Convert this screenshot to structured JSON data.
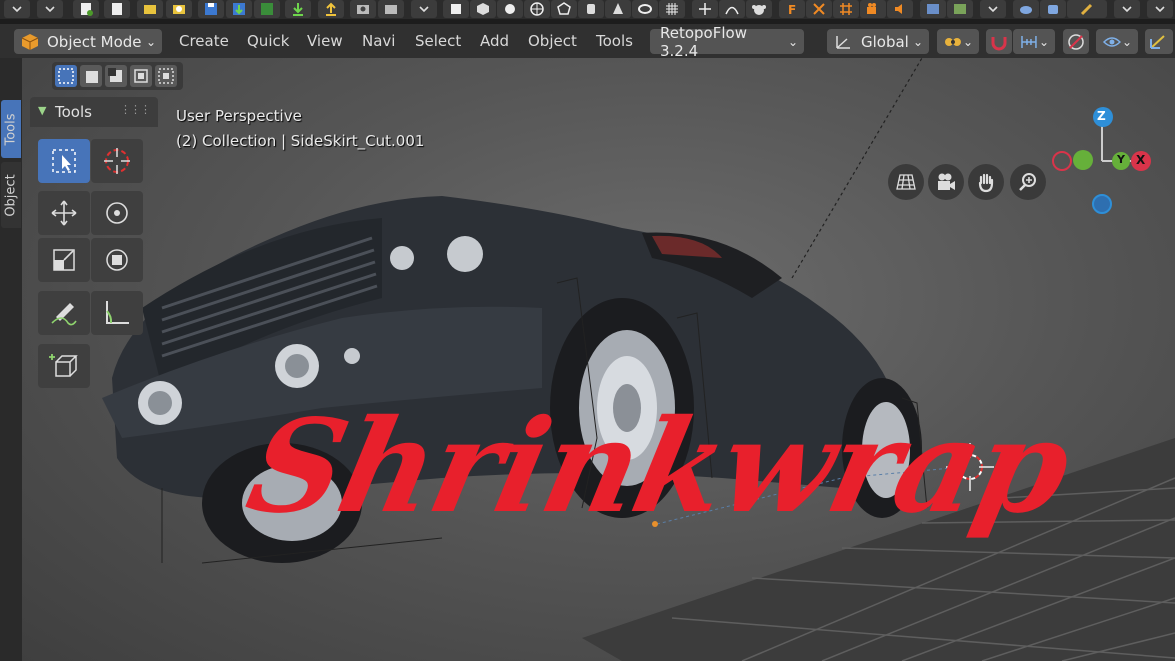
{
  "header": {
    "mode_label": "Object Mode",
    "menu": [
      "Create",
      "Quick",
      "View",
      "Navi",
      "Select",
      "Add",
      "Object",
      "Tools"
    ],
    "addon_label": "RetopoFlow 3.2.4",
    "transform_orientation": "Global"
  },
  "left_tabs": [
    "Tools",
    "Object"
  ],
  "tools_panel": {
    "title": "Tools"
  },
  "viewport": {
    "view_name": "User Perspective",
    "collection_info": "(2) Collection | SideSkirt_Cut.001"
  },
  "gizmo": {
    "z_label": "Z",
    "y_label": "Y",
    "x_label": "X"
  },
  "overlay_title": "Shrinkwrap",
  "colors": {
    "accent_blue": "#4774b9",
    "title_red": "#e8202c",
    "axis_x": "#d9344a",
    "axis_y": "#66b03a",
    "axis_z": "#2e8fd8"
  }
}
